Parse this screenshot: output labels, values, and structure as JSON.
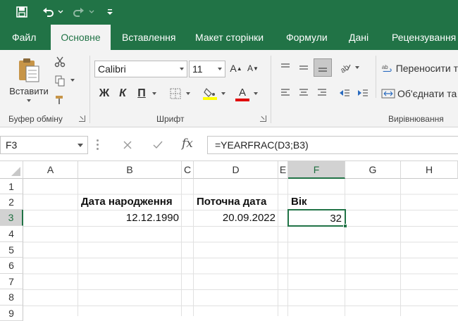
{
  "quick_access": {
    "save_icon": "save-icon",
    "undo_icon": "undo-icon",
    "redo_icon": "redo-icon",
    "customize_icon": "customize-qat-icon"
  },
  "tabs": [
    "Файл",
    "Основне",
    "Вставлення",
    "Макет сторінки",
    "Формули",
    "Дані",
    "Рецензування"
  ],
  "active_tab": "Основне",
  "ribbon": {
    "clipboard": {
      "paste_label": "Вставити",
      "group_label": "Буфер обміну"
    },
    "font": {
      "font_name": "Calibri",
      "font_size": "11",
      "bold": "Ж",
      "italic": "К",
      "underline": "П",
      "group_label": "Шрифт"
    },
    "alignment": {
      "wrap_text": "Переносити т",
      "merge": "Об'єднати та",
      "group_label": "Вирівнювання"
    }
  },
  "formula_bar": {
    "name_box": "F3",
    "fx": "fx",
    "formula": "=YEARFRAC(D3;B3)"
  },
  "sheet": {
    "columns": [
      "A",
      "B",
      "C",
      "D",
      "E",
      "F",
      "G",
      "H"
    ],
    "rows": [
      "1",
      "2",
      "3",
      "4",
      "5",
      "6",
      "7",
      "8",
      "9"
    ],
    "selected_cell": "F3",
    "cells": {
      "B2": "Дата народження",
      "D2": "Поточна дата",
      "F2": "Вік",
      "B3": "12.12.1990",
      "D3": "20.09.2022",
      "F3": "32"
    }
  },
  "colors": {
    "accent": "#217346",
    "ribbon_bg": "#f3f3f3",
    "font_color_bar": "#e00000",
    "highlight_bar": "#ffff00"
  }
}
